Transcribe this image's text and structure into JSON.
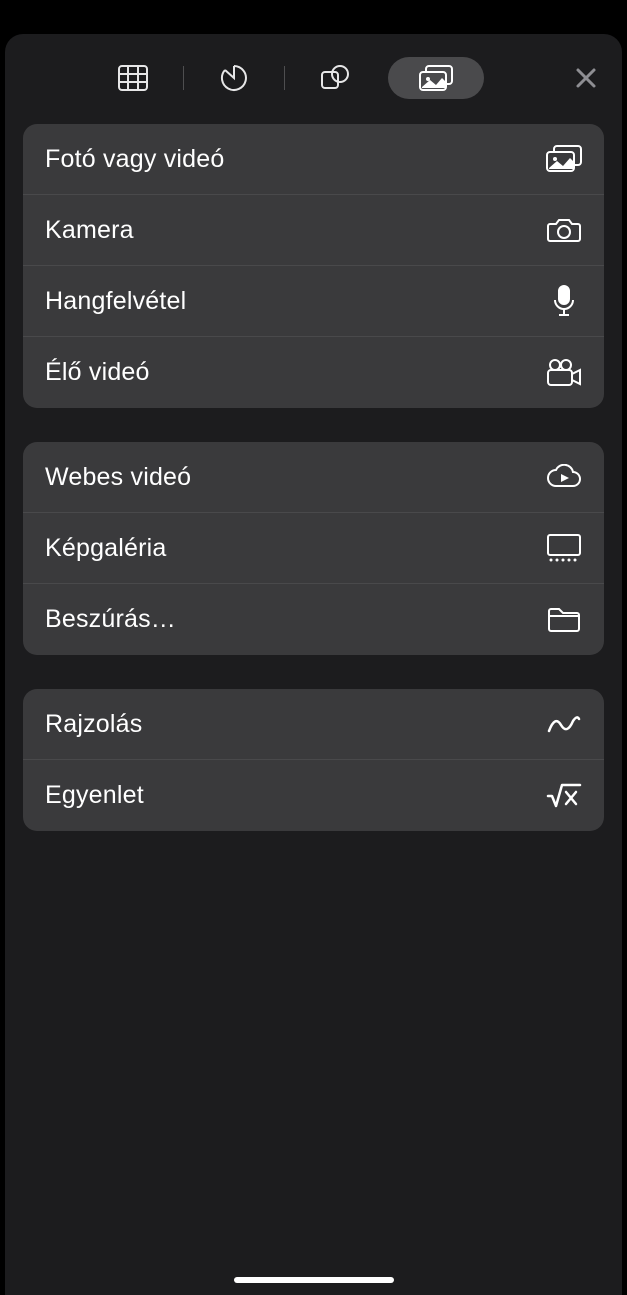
{
  "tabs": {
    "selected_index": 3
  },
  "groups": [
    {
      "key": "media",
      "items": [
        {
          "label": "Fotó vagy videó",
          "icon": "photo-video-icon",
          "name": "row-photo-video"
        },
        {
          "label": "Kamera",
          "icon": "camera-icon",
          "name": "row-camera"
        },
        {
          "label": "Hangfelvétel",
          "icon": "microphone-icon",
          "name": "row-audio-record"
        },
        {
          "label": "Élő videó",
          "icon": "video-camera-icon",
          "name": "row-live-video"
        }
      ]
    },
    {
      "key": "web",
      "items": [
        {
          "label": "Webes videó",
          "icon": "cloud-play-icon",
          "name": "row-web-video"
        },
        {
          "label": "Képgaléria",
          "icon": "gallery-icon",
          "name": "row-image-gallery"
        },
        {
          "label": "Beszúrás…",
          "icon": "folder-icon",
          "name": "row-insert-from"
        }
      ]
    },
    {
      "key": "draw",
      "items": [
        {
          "label": "Rajzolás",
          "icon": "scribble-icon",
          "name": "row-drawing"
        },
        {
          "label": "Egyenlet",
          "icon": "equation-icon",
          "name": "row-equation"
        }
      ]
    }
  ]
}
